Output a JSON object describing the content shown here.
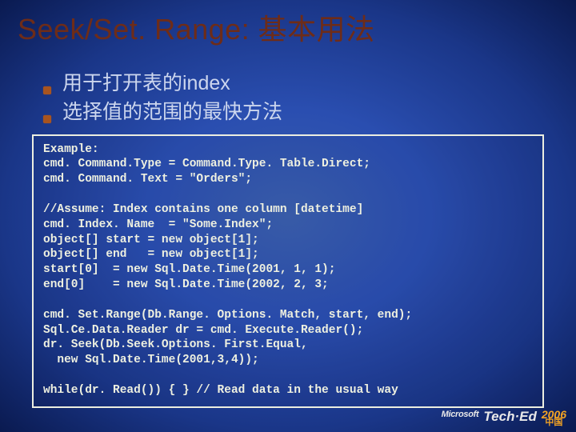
{
  "title": "Seek/Set. Range:  基本用法",
  "bullets": [
    "用于打开表的index",
    "选择值的范围的最快方法"
  ],
  "code": "Example:\ncmd. Command.Type = Command.Type. Table.Direct;\ncmd. Command. Text = \"Orders\";\n\n//Assume: Index contains one column [datetime]\ncmd. Index. Name  = \"Some.Index\";\nobject[] start = new object[1];\nobject[] end   = new object[1];\nstart[0]  = new Sql.Date.Time(2001, 1, 1);\nend[0]    = new Sql.Date.Time(2002, 2, 3;\n\ncmd. Set.Range(Db.Range. Options. Match, start, end);\nSql.Ce.Data.Reader dr = cmd. Execute.Reader();\ndr. Seek(Db.Seek.Options. First.Equal,\n  new Sql.Date.Time(2001,3,4));\n\nwhile(dr. Read()) { } // Read data in the usual way",
  "brand": {
    "company": "Microsoft",
    "event": "Tech·Ed",
    "year": "2006",
    "region": "中国"
  }
}
